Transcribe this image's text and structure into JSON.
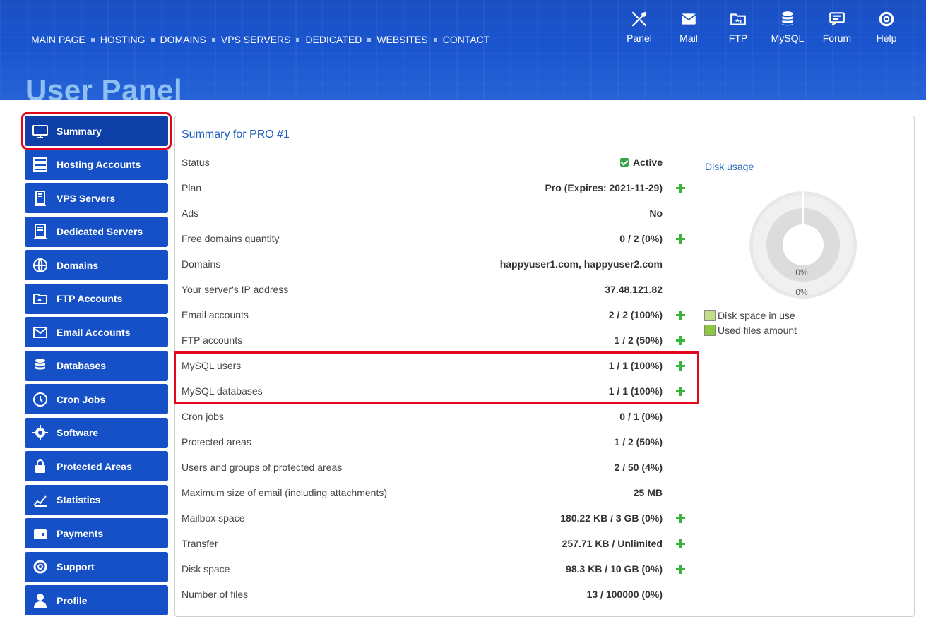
{
  "topnav": [
    "MAIN PAGE",
    "HOSTING",
    "DOMAINS",
    "VPS SERVERS",
    "DEDICATED",
    "WEBSITES",
    "CONTACT"
  ],
  "icons": [
    {
      "label": "Panel",
      "icon": "tools-icon"
    },
    {
      "label": "Mail",
      "icon": "mail-icon"
    },
    {
      "label": "FTP",
      "icon": "ftp-folder-icon"
    },
    {
      "label": "MySQL",
      "icon": "database-icon"
    },
    {
      "label": "Forum",
      "icon": "forum-icon"
    },
    {
      "label": "Help",
      "icon": "lifebuoy-icon"
    }
  ],
  "page_title": "User Panel",
  "sidebar": {
    "items": [
      {
        "label": "Summary",
        "icon": "monitor-icon",
        "active": true
      },
      {
        "label": "Hosting Accounts",
        "icon": "server-icon"
      },
      {
        "label": "VPS Servers",
        "icon": "vps-icon"
      },
      {
        "label": "Dedicated Servers",
        "icon": "dedicated-icon"
      },
      {
        "label": "Domains",
        "icon": "globe-icon"
      },
      {
        "label": "FTP Accounts",
        "icon": "ftp-folder-icon"
      },
      {
        "label": "Email Accounts",
        "icon": "mail-icon"
      },
      {
        "label": "Databases",
        "icon": "database-icon"
      },
      {
        "label": "Cron Jobs",
        "icon": "clock-icon"
      },
      {
        "label": "Software",
        "icon": "gear-icon"
      },
      {
        "label": "Protected Areas",
        "icon": "lock-icon"
      },
      {
        "label": "Statistics",
        "icon": "chart-icon"
      },
      {
        "label": "Payments",
        "icon": "wallet-icon"
      },
      {
        "label": "Support",
        "icon": "lifebuoy-icon"
      },
      {
        "label": "Profile",
        "icon": "user-icon"
      }
    ]
  },
  "summary": {
    "title": "Summary for PRO #1",
    "rows": [
      {
        "label": "Status",
        "value": "Active",
        "check": true,
        "plus": false
      },
      {
        "label": "Plan",
        "value": "Pro (Expires: 2021-11-29)",
        "plus": true
      },
      {
        "label": "Ads",
        "value": "No",
        "plus": false
      },
      {
        "label": "Free domains quantity",
        "value": "0 / 2 (0%)",
        "plus": true
      },
      {
        "label": "Domains",
        "value": "happyuser1.com, happyuser2.com",
        "plus": false
      },
      {
        "label": "Your server's IP address",
        "value": "37.48.121.82",
        "plus": false
      },
      {
        "label": "Email accounts",
        "value": "2 / 2 (100%)",
        "plus": true
      },
      {
        "label": "FTP accounts",
        "value": "1 / 2 (50%)",
        "plus": true
      },
      {
        "label": "MySQL users",
        "value": "1 / 1 (100%)",
        "plus": true
      },
      {
        "label": "MySQL databases",
        "value": "1 / 1 (100%)",
        "plus": true
      },
      {
        "label": "Cron jobs",
        "value": "0 / 1 (0%)",
        "plus": false
      },
      {
        "label": "Protected areas",
        "value": "1 / 2 (50%)",
        "plus": false
      },
      {
        "label": "Users and groups of protected areas",
        "value": "2 / 50 (4%)",
        "plus": false
      },
      {
        "label": "Maximum size of email (including attachments)",
        "value": "25 MB",
        "plus": false
      },
      {
        "label": "Mailbox space",
        "value": "180.22 KB / 3 GB (0%)",
        "plus": true
      },
      {
        "label": "Transfer",
        "value": "257.71 KB / Unlimited",
        "plus": true
      },
      {
        "label": "Disk space",
        "value": "98.3 KB / 10 GB (0%)",
        "plus": true
      },
      {
        "label": "Number of files",
        "value": "13 / 100000 (0%)",
        "plus": false
      }
    ]
  },
  "disk_usage": {
    "title": "Disk usage",
    "inner_label": "0%",
    "outer_label": "0%",
    "legend": [
      {
        "label": "Disk space in use",
        "color": "#c2dd8a"
      },
      {
        "label": "Used files amount",
        "color": "#8dc63f"
      }
    ]
  },
  "colors": {
    "brand": "#1550c6",
    "highlight": "#e3051b",
    "plus": "#3ab53c"
  }
}
